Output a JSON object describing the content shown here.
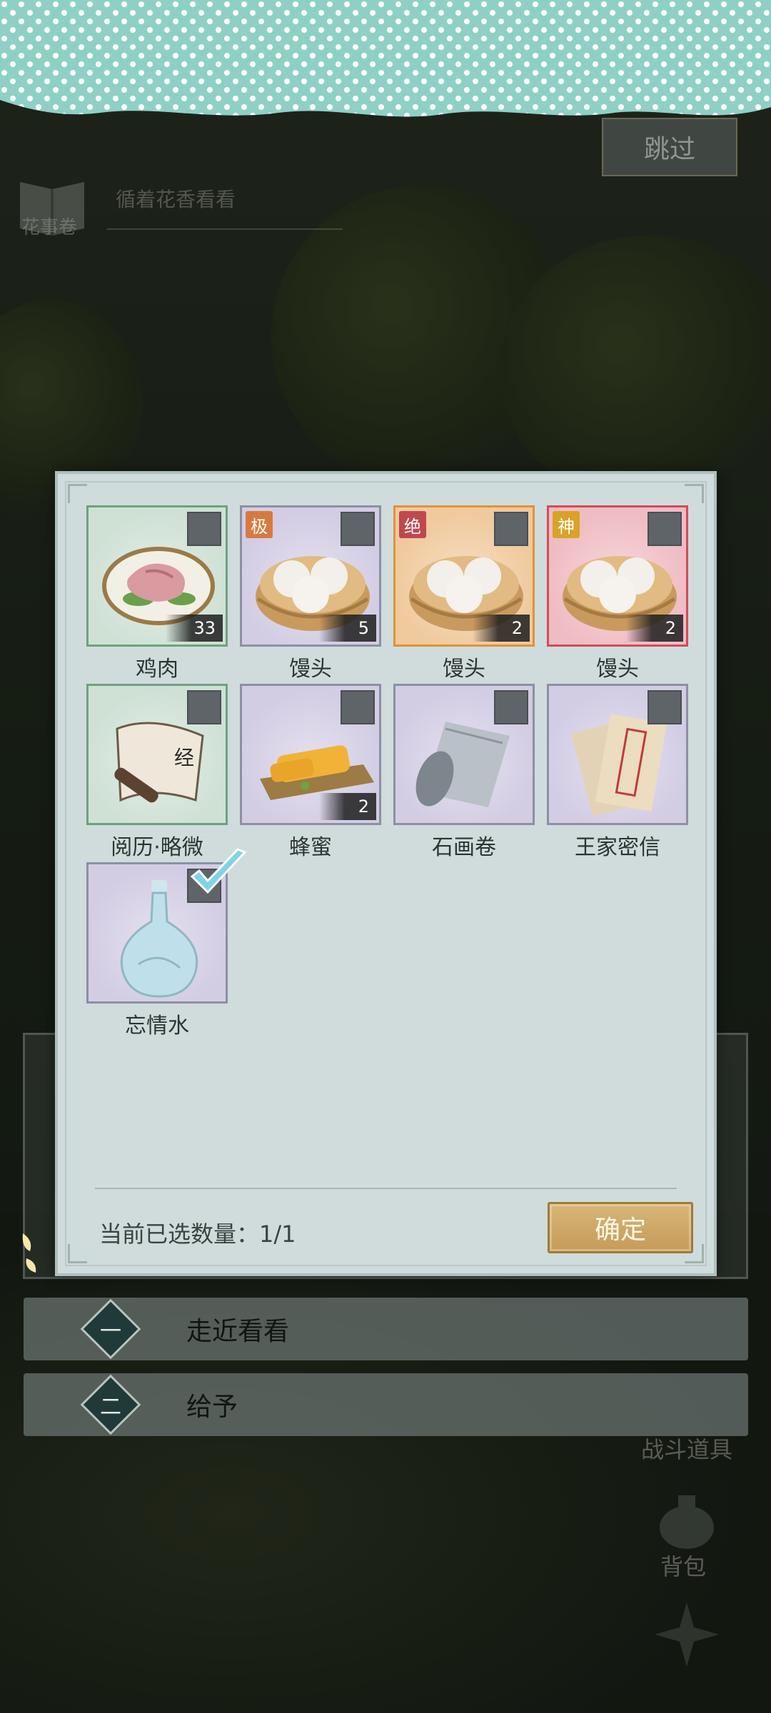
{
  "header": {
    "skip_label": "跳过"
  },
  "quest": {
    "book_label": "花事卷",
    "hint": "循着花香看看"
  },
  "side_menu": {
    "battle_items_label": "战斗道具",
    "bag_label": "背包"
  },
  "choices": [
    {
      "number": "一",
      "label": "走近看看"
    },
    {
      "number": "二",
      "label": "给予"
    }
  ],
  "inventory": {
    "items": [
      {
        "name": "鸡肉",
        "count": "33",
        "grade": "",
        "rarity": "green",
        "icon": "chicken-meat-icon",
        "selected": false
      },
      {
        "name": "馒头",
        "count": "5",
        "grade": "极",
        "rarity": "purple",
        "icon": "steamed-bun-icon",
        "selected": false
      },
      {
        "name": "馒头",
        "count": "2",
        "grade": "绝",
        "rarity": "orange",
        "icon": "steamed-bun-icon",
        "selected": false
      },
      {
        "name": "馒头",
        "count": "2",
        "grade": "神",
        "rarity": "red",
        "icon": "steamed-bun-icon",
        "selected": false
      },
      {
        "name": "阅历·略微",
        "count": "",
        "grade": "",
        "rarity": "green",
        "icon": "scroll-icon",
        "selected": false
      },
      {
        "name": "蜂蜜",
        "count": "2",
        "grade": "",
        "rarity": "purple",
        "icon": "honey-icon",
        "selected": false
      },
      {
        "name": "石画卷",
        "count": "",
        "grade": "",
        "rarity": "purple",
        "icon": "stone-scroll-icon",
        "selected": false
      },
      {
        "name": "王家密信",
        "count": "",
        "grade": "",
        "rarity": "purple",
        "icon": "letter-icon",
        "selected": false
      },
      {
        "name": "忘情水",
        "count": "",
        "grade": "",
        "rarity": "purple",
        "icon": "vase-icon",
        "selected": true
      }
    ],
    "selected_label": "当前已选数量：1/1",
    "confirm_label": "确定"
  },
  "colors": {
    "modal_bg": "#cfdcdb",
    "confirm_gold": "#c59b58",
    "banner_teal": "#8fd0c6"
  }
}
